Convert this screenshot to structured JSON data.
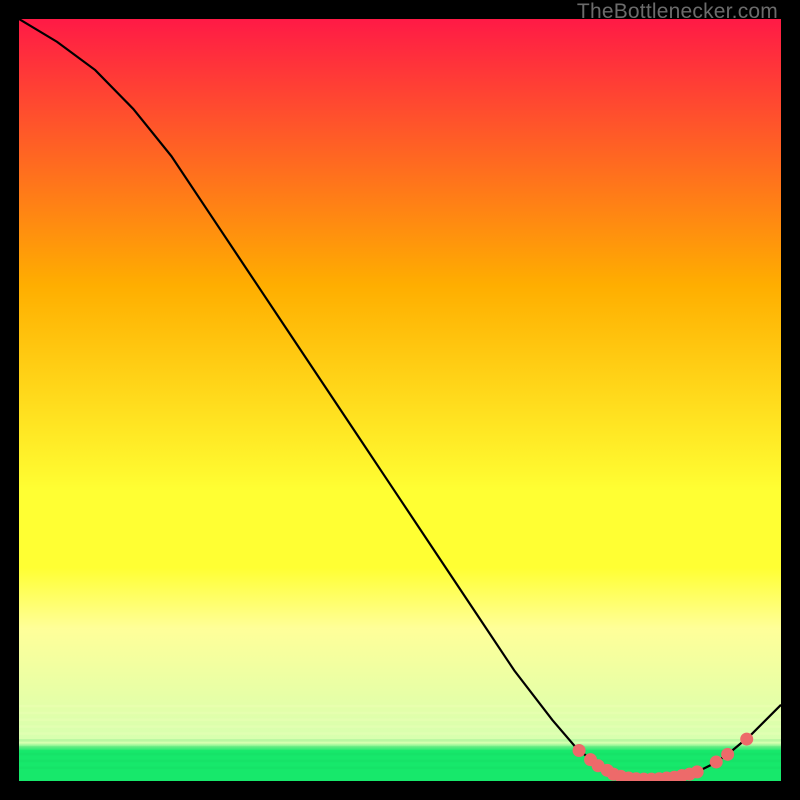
{
  "watermark": "TheBottlenecker.com",
  "chart_data": {
    "type": "line",
    "title": "",
    "xlabel": "",
    "ylabel": "",
    "xlim": [
      0,
      100
    ],
    "ylim": [
      0,
      100
    ],
    "background": {
      "top_color": "#ff1a46",
      "mid_upper_color": "#ffae00",
      "mid_lower_color": "#ffff33",
      "pale_color": "#ffff99",
      "bottom_color": "#17e86b",
      "transition_pale_at": 72,
      "transition_green_at": 96
    },
    "curve": {
      "color": "#000000",
      "width": 2.2,
      "points_xy": [
        [
          0,
          100
        ],
        [
          5,
          97.0
        ],
        [
          10,
          93.3
        ],
        [
          15,
          88.2
        ],
        [
          20,
          82.0
        ],
        [
          25,
          74.5
        ],
        [
          30,
          67.0
        ],
        [
          35,
          59.5
        ],
        [
          40,
          52.0
        ],
        [
          45,
          44.5
        ],
        [
          50,
          37.0
        ],
        [
          55,
          29.5
        ],
        [
          60,
          22.0
        ],
        [
          65,
          14.5
        ],
        [
          70,
          8.0
        ],
        [
          73,
          4.5
        ],
        [
          76,
          2.0
        ],
        [
          78,
          0.8
        ],
        [
          80,
          0.3
        ],
        [
          83,
          0.2
        ],
        [
          86,
          0.4
        ],
        [
          89,
          1.2
        ],
        [
          91,
          2.2
        ],
        [
          93,
          3.5
        ],
        [
          96,
          6.0
        ],
        [
          100,
          10.0
        ]
      ]
    },
    "markers": {
      "color": "#ed6a6a",
      "radius": 6.5,
      "points_xy": [
        [
          73.5,
          4.0
        ],
        [
          75.0,
          2.8
        ],
        [
          76.0,
          2.0
        ],
        [
          77.2,
          1.4
        ],
        [
          78.0,
          0.9
        ],
        [
          79.0,
          0.6
        ],
        [
          80.0,
          0.4
        ],
        [
          81.0,
          0.3
        ],
        [
          82.0,
          0.25
        ],
        [
          83.0,
          0.25
        ],
        [
          84.0,
          0.3
        ],
        [
          85.0,
          0.4
        ],
        [
          86.0,
          0.5
        ],
        [
          87.0,
          0.7
        ],
        [
          88.0,
          0.9
        ],
        [
          89.0,
          1.2
        ],
        [
          91.5,
          2.5
        ],
        [
          93.0,
          3.5
        ],
        [
          95.5,
          5.5
        ]
      ]
    }
  }
}
